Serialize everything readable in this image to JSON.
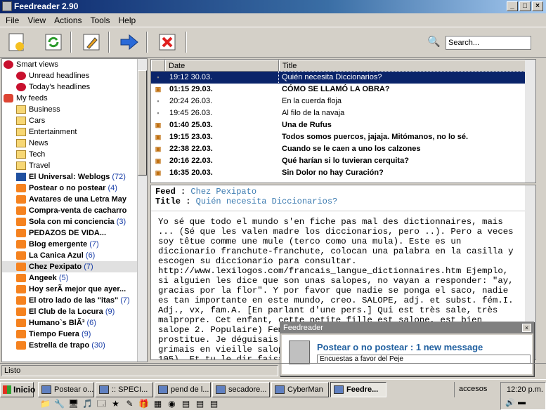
{
  "window": {
    "title": "Feedreader 2.90",
    "buttons": [
      "_",
      "□",
      "×"
    ]
  },
  "menu": [
    "File",
    "View",
    "Actions",
    "Tools",
    "Help"
  ],
  "toolbar": {
    "search_value": "Search..."
  },
  "tree": [
    {
      "label": "Smart views",
      "icon": "redball",
      "indent": 0,
      "bold": false
    },
    {
      "label": "Unread headlines",
      "icon": "redball",
      "indent": 1,
      "bold": false
    },
    {
      "label": "Today's headlines",
      "icon": "redball",
      "indent": 1,
      "bold": false
    },
    {
      "label": "My feeds",
      "icon": "feedsic",
      "indent": 0,
      "bold": false
    },
    {
      "label": "Business",
      "icon": "folder",
      "indent": 1,
      "bold": false
    },
    {
      "label": "Cars",
      "icon": "folder",
      "indent": 1,
      "bold": false
    },
    {
      "label": "Entertainment",
      "icon": "folder",
      "indent": 1,
      "bold": false
    },
    {
      "label": "News",
      "icon": "folder",
      "indent": 1,
      "bold": false
    },
    {
      "label": "Tech",
      "icon": "folder",
      "indent": 1,
      "bold": false
    },
    {
      "label": "Travel",
      "icon": "folder",
      "indent": 1,
      "bold": false
    },
    {
      "label": "El Universal: Weblogs",
      "count": "(72)",
      "icon": "univ",
      "indent": 1,
      "bold": true
    },
    {
      "label": "Postear o no postear",
      "count": "(4)",
      "icon": "blog",
      "indent": 1,
      "bold": true
    },
    {
      "label": "Avatares de una Letra May",
      "icon": "blog",
      "indent": 1,
      "bold": true
    },
    {
      "label": "Compra-venta de cacharro",
      "icon": "blog",
      "indent": 1,
      "bold": true
    },
    {
      "label": "Sola con mi conciencia",
      "count": "(3)",
      "icon": "blog",
      "indent": 1,
      "bold": true
    },
    {
      "label": "PEDAZOS DE VIDA...",
      "icon": "blog",
      "indent": 1,
      "bold": true
    },
    {
      "label": "Blog emergente",
      "count": "(7)",
      "icon": "blog",
      "indent": 1,
      "bold": true
    },
    {
      "label": "La Canica Azul",
      "count": "(6)",
      "icon": "blog",
      "indent": 1,
      "bold": true
    },
    {
      "label": "Chez Pexipato",
      "count": "(7)",
      "icon": "blog",
      "indent": 1,
      "bold": true,
      "selected": true
    },
    {
      "label": "Angeek",
      "count": "(5)",
      "icon": "blog",
      "indent": 1,
      "bold": true
    },
    {
      "label": "Hoy serÃ mejor que ayer...",
      "icon": "blog",
      "indent": 1,
      "bold": true
    },
    {
      "label": "El otro lado de las \"itas\"",
      "count": "(7)",
      "icon": "blog",
      "indent": 1,
      "bold": true
    },
    {
      "label": "El Club de la Locura",
      "count": "(9)",
      "icon": "blog",
      "indent": 1,
      "bold": true
    },
    {
      "label": "Humano`s BlÃ³",
      "count": "(6)",
      "icon": "blog",
      "indent": 1,
      "bold": true
    },
    {
      "label": "Tiempo Fuera",
      "count": "(9)",
      "icon": "blog",
      "indent": 1,
      "bold": true
    },
    {
      "label": "Estrella de trapo",
      "count": "(30)",
      "icon": "blog",
      "indent": 1,
      "bold": true
    }
  ],
  "list": {
    "columns": [
      "Date",
      "Title"
    ],
    "rows": [
      {
        "date": "19:12 30.03.",
        "title": "Quién necesita Diccionarios?",
        "bold": false,
        "selected": true
      },
      {
        "date": "01:15 29.03.",
        "title": "CÓMO SE LLAMÓ LA OBRA?",
        "bold": true
      },
      {
        "date": "20:24 26.03.",
        "title": "En la cuerda floja",
        "bold": false
      },
      {
        "date": "19:45 26.03.",
        "title": "Al filo de la navaja",
        "bold": false
      },
      {
        "date": "01:40 25.03.",
        "title": "Una de Rufus",
        "bold": true
      },
      {
        "date": "19:15 23.03.",
        "title": "Todos somos puercos, jajaja. Mitómanos, no lo sé.",
        "bold": true
      },
      {
        "date": "22:38 22.03.",
        "title": "Cuando se le caen a uno los calzones",
        "bold": true
      },
      {
        "date": "20:16 22.03.",
        "title": "Qué harían si lo tuvieran cerquita?",
        "bold": true
      },
      {
        "date": "16:35 20.03.",
        "title": "Sin Dolor no hay Curación?",
        "bold": true
      }
    ]
  },
  "preview": {
    "feed_label": "Feed :",
    "feed": "Chez Pexipato",
    "title_label": "Title :",
    "title": "Quién necesita Diccionarios?",
    "body": "Yo sé que todo el mundo s'en fiche pas mal des dictionnaires, mais ... (Sé que les valen madre los diccionarios, pero ..). Pero a veces soy têtue comme une mule (terco como una mula). Este es un diccionario franchute-franchute, colocan una palabra en la casilla y escogen su diccionario para consultar. http://www.lexilogos.com/francais_langue_dictionnaires.htm Ejemplo, si alguien les dice que son unas salopes, no vayan a responder: \"ay, gracias por la flor\". Y por favor que nadie se ponga el saco, nadie es tan importante en este mundo, creo. SALOPE, adj. et subst. fém.I. Adj., vx, fam.A. [En parlant d'une pers.] Qui est très sale, très malpropre. Cet enfant, cette petite fille est salope, est bien salope 2. Populaire) Femme débauchée, de mœurs dépravées, ou qui se prostitue. Je déguisais ma chère maîtresse en bardache. je la grimais en vieille salope, lupanar, je baignais mon ch 1910, p. 105). Et tu le dir faisait la vie pendant que t"
  },
  "popup": {
    "header": "Feedreader",
    "title": "Postear o no postear : 1 new message",
    "subtitle": "Encuestas a favor del Peje",
    "close": "×"
  },
  "status": {
    "text": "Listo"
  },
  "taskbar": {
    "start": "Inicio",
    "buttons": [
      {
        "label": "Postear o..."
      },
      {
        "label": ":: SPECI..."
      },
      {
        "label": "pend de l..."
      },
      {
        "label": "secadore..."
      },
      {
        "label": "CyberMan"
      },
      {
        "label": "Feedre...",
        "active": true
      }
    ],
    "accesos": "accesos",
    "clock": "12:20 p.m."
  }
}
